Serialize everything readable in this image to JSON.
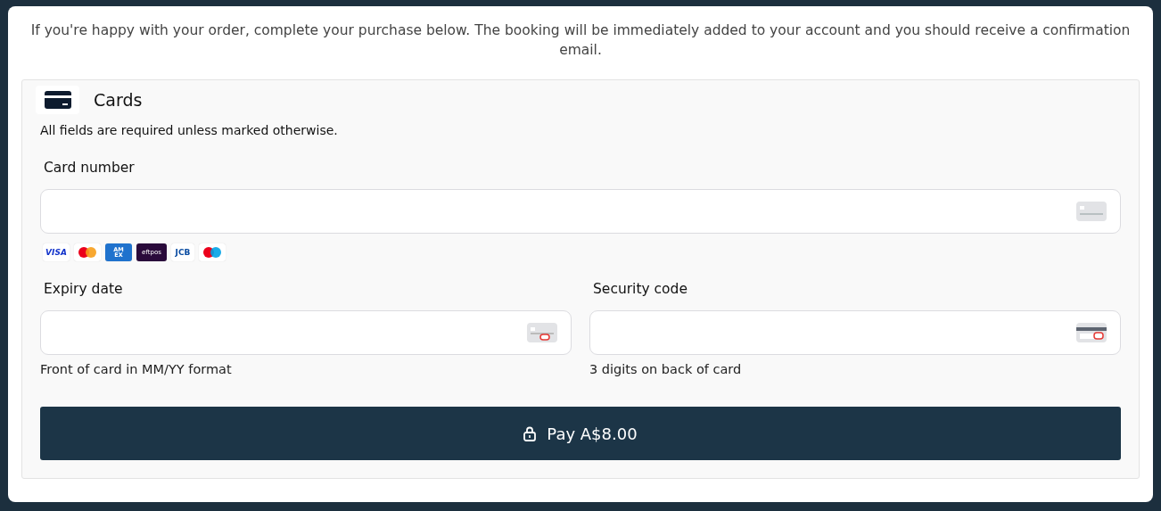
{
  "intro": "If you're happy with your order, complete your purchase below. The booking will be immediately added to your account and you should receive a confirmation email.",
  "payment": {
    "title": "Cards",
    "note": "All fields are required unless marked otherwise.",
    "card_number": {
      "label": "Card number"
    },
    "brands": [
      {
        "kind": "visa",
        "text": "VISA"
      },
      {
        "kind": "mastercard"
      },
      {
        "kind": "amex",
        "text": "AM EX"
      },
      {
        "kind": "eftpos",
        "text": "eftpos"
      },
      {
        "kind": "jcb",
        "text": "JCB"
      },
      {
        "kind": "maestro"
      }
    ],
    "fields": [
      {
        "kind": "expiry",
        "label": "Expiry date",
        "hint": "Front of card in MM/YY format"
      },
      {
        "kind": "cvc",
        "label": "Security code",
        "hint": "3 digits on back of card"
      }
    ],
    "button": "Pay A$8.00"
  }
}
